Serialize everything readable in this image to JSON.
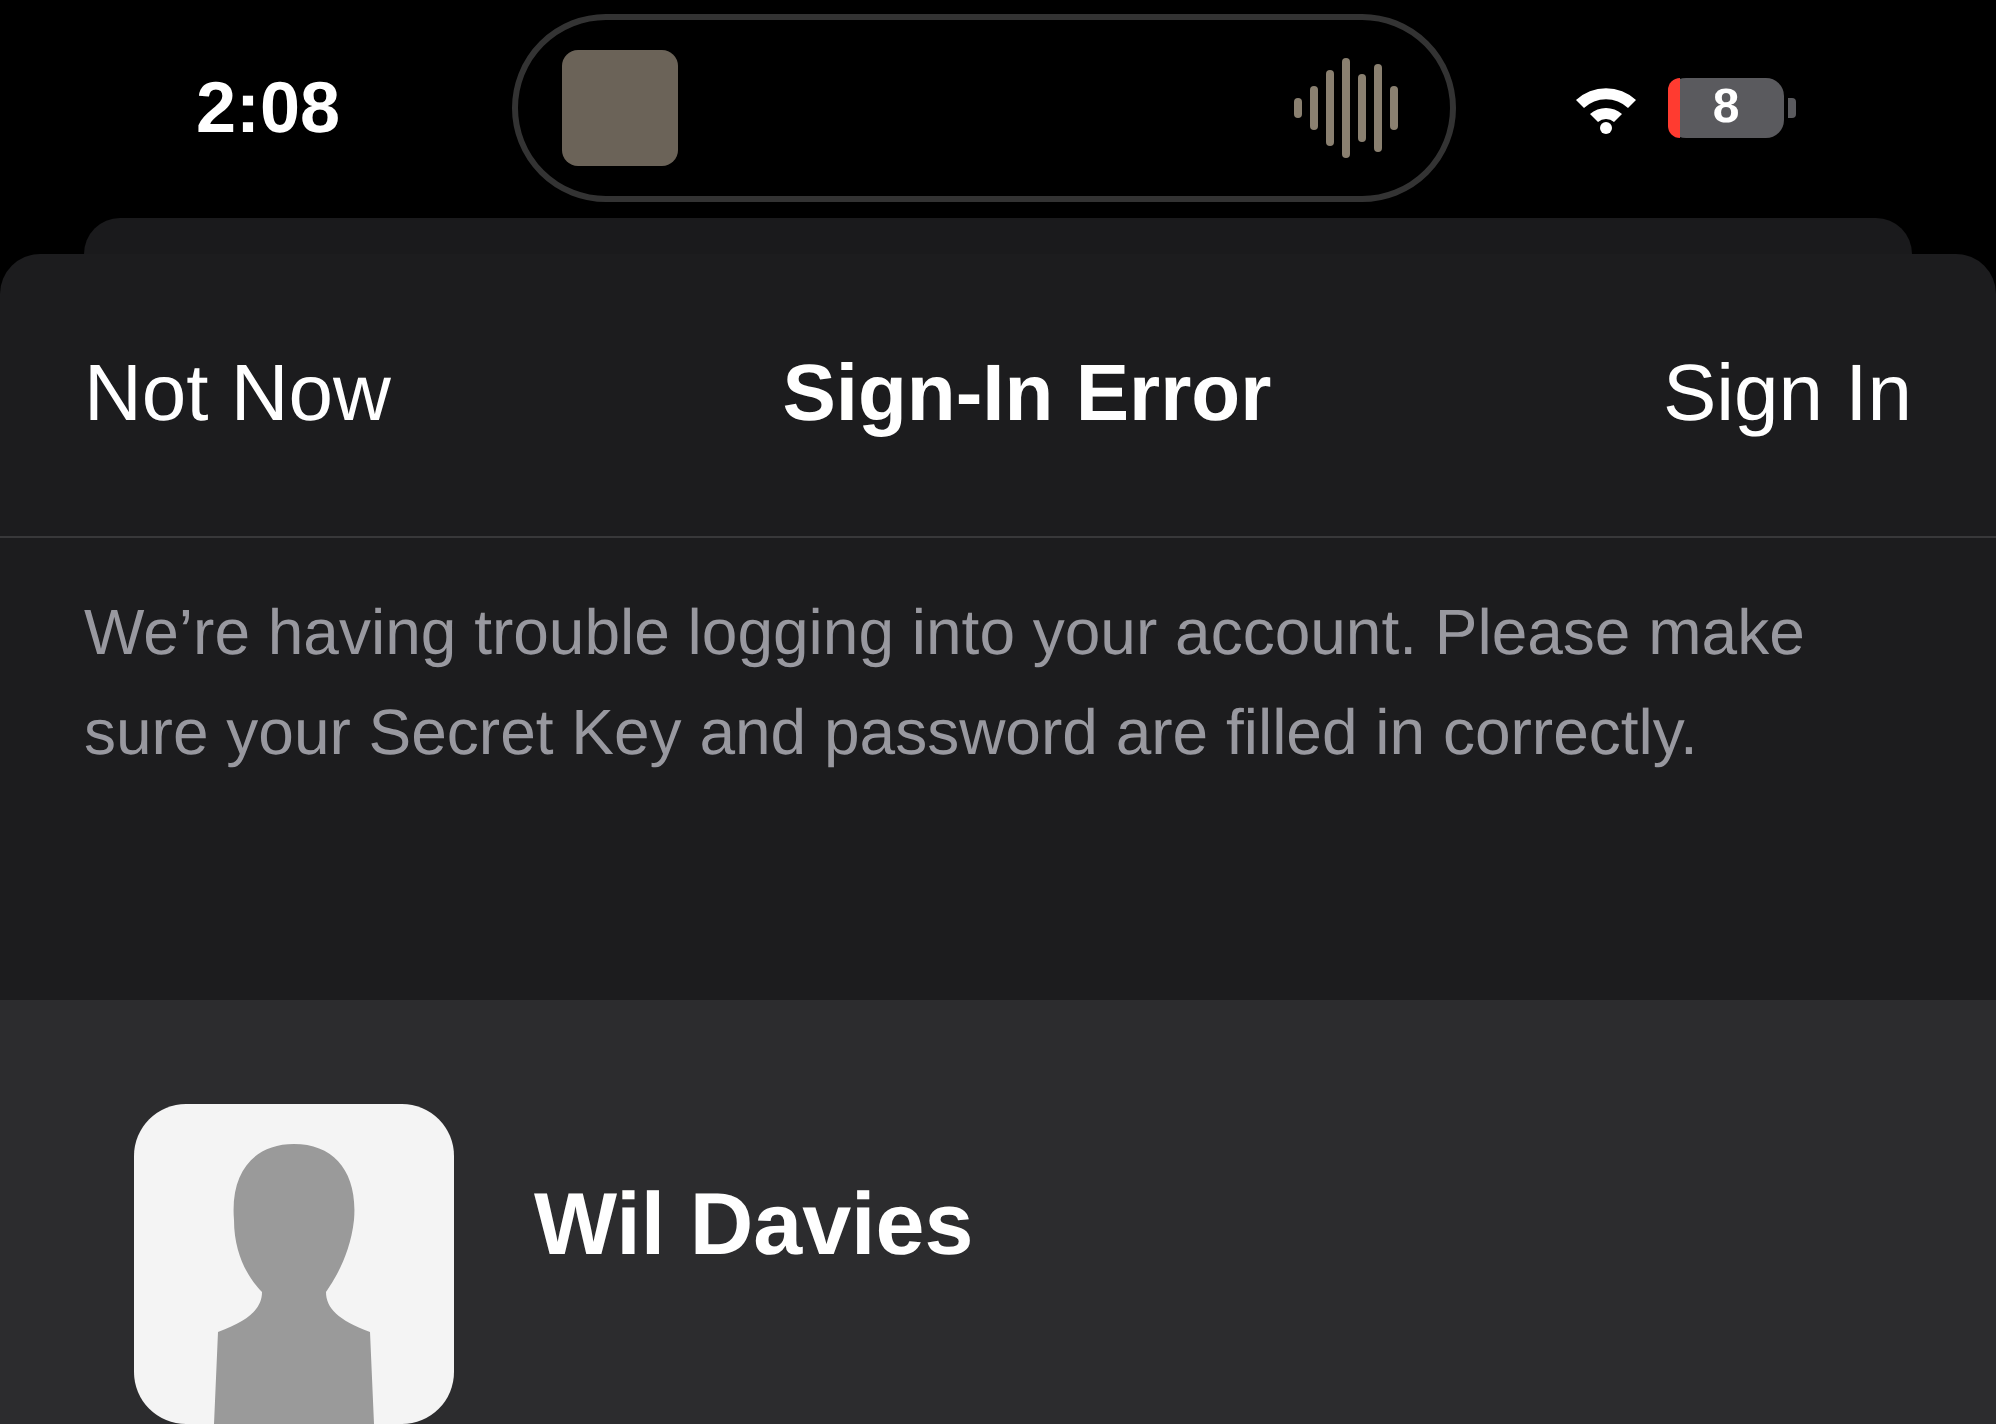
{
  "status_bar": {
    "time": "2:08",
    "battery": "8"
  },
  "sheet": {
    "cancel": "Not Now",
    "title": "Sign-In Error",
    "confirm": "Sign In",
    "message": "We’re having trouble logging into your account. Please make sure your Secret Key and password are filled in correctly."
  },
  "account": {
    "name": "Wil Davies"
  }
}
